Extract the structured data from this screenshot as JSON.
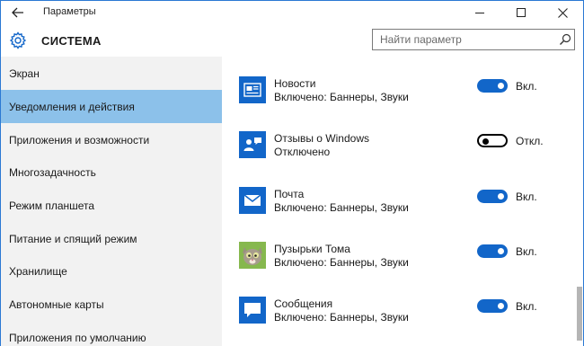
{
  "window": {
    "title": "Параметры",
    "controls": {
      "minimize": "minimize-icon",
      "maximize": "maximize-icon",
      "close": "close-icon"
    }
  },
  "header": {
    "section_title": "СИСТЕМА",
    "icon": "gear-icon"
  },
  "search": {
    "placeholder": "Найти параметр",
    "value": ""
  },
  "sidebar": {
    "items": [
      {
        "label": "Экран",
        "active": false
      },
      {
        "label": "Уведомления и действия",
        "active": true
      },
      {
        "label": "Приложения и возможности",
        "active": false
      },
      {
        "label": "Многозадачность",
        "active": false
      },
      {
        "label": "Режим планшета",
        "active": false
      },
      {
        "label": "Питание и спящий режим",
        "active": false
      },
      {
        "label": "Хранилище",
        "active": false
      },
      {
        "label": "Автономные карты",
        "active": false
      },
      {
        "label": "Приложения по умолчанию",
        "active": false
      }
    ]
  },
  "apps": [
    {
      "name": "Новости",
      "status": "Включено: Баннеры, Звуки",
      "toggle_on": true,
      "toggle_label": "Вкл.",
      "icon": "news-icon"
    },
    {
      "name": "Отзывы о Windows",
      "status": "Отключено",
      "toggle_on": false,
      "toggle_label": "Откл.",
      "icon": "feedback-icon"
    },
    {
      "name": "Почта",
      "status": "Включено: Баннеры, Звуки",
      "toggle_on": true,
      "toggle_label": "Вкл.",
      "icon": "mail-icon"
    },
    {
      "name": "Пузырьки Тома",
      "status": "Включено: Баннеры, Звуки",
      "toggle_on": true,
      "toggle_label": "Вкл.",
      "icon": "talking-tom-icon"
    },
    {
      "name": "Сообщения",
      "status": "Включено: Баннеры, Звуки",
      "toggle_on": true,
      "toggle_label": "Вкл.",
      "icon": "messaging-icon"
    }
  ],
  "colors": {
    "accent": "#1266c9",
    "active_nav": "#8cc1ea",
    "sidebar_bg": "#f2f2f2",
    "window_border": "#2b79d3"
  }
}
